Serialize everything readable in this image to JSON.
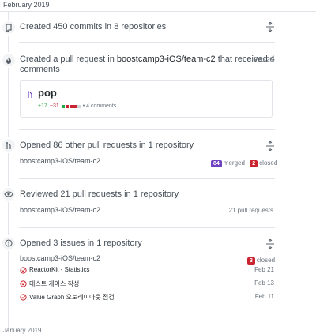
{
  "month_header": "February 2019",
  "items": [
    {
      "icon": "repo-push-icon",
      "title": "Created 450 commits in 8 repositories"
    },
    {
      "icon": "flame-icon",
      "title_prefix": "Created a pull request in",
      "repo_link": "boostcamp3-iOS/team-c2",
      "title_suffix": "that received 4",
      "title_line2": "comments",
      "date": "Feb 20",
      "pr": {
        "title": "pop",
        "additions": "+17",
        "deletions": "−31",
        "comments": "• 4 comments"
      }
    },
    {
      "icon": "git-pull-request-icon",
      "title": "Opened 86 other pull requests in 1 repository",
      "repo": "boostcamp3-iOS/team-c2",
      "merged_count": "84",
      "merged_label": "merged",
      "closed_count": "2",
      "closed_label": "closed"
    },
    {
      "icon": "eye-icon",
      "title": "Reviewed 21 pull requests in 1 repository",
      "repo": "boostcamp3-iOS/team-c2",
      "count_label": "21 pull requests"
    },
    {
      "icon": "issue-opened-icon",
      "title": "Opened 3 issues in 1 repository",
      "repo": "boostcamp3-iOS/team-c2",
      "closed_count": "3",
      "closed_label": "closed",
      "issues": [
        {
          "title": "ReactorKit - Statistics",
          "date": "Feb 21"
        },
        {
          "title": "테스트 케이스 작성",
          "date": "Feb 13"
        },
        {
          "title": "Value Graph 오토레이아웃 점검",
          "date": "Feb 11"
        }
      ]
    }
  ],
  "next_month_header": "January 2019",
  "colors": {
    "merged": "#6f42c1",
    "closed": "#cb2431",
    "additions": "#28a745",
    "deletions": "#cb2431"
  }
}
